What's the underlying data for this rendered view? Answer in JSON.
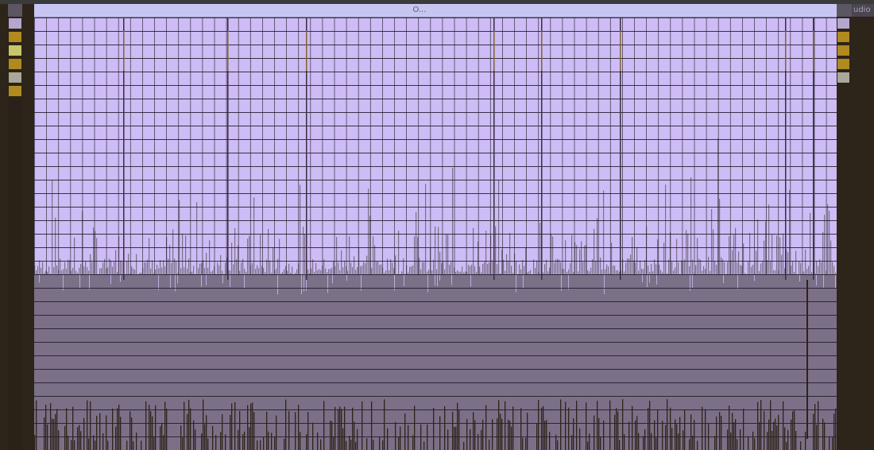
{
  "main_clip": {
    "title": "O..."
  },
  "right_track": {
    "label": "udio"
  },
  "colors": {
    "clip_fill": "#cdbcf5",
    "clip_header": "#c7c6f2",
    "clip_shadow": "#7c7088",
    "background": "#2d241a",
    "grid_line": "#1f1a24",
    "accent_gold": "#b08a1f",
    "accent_yellow_green": "#c9c46a"
  },
  "left_mini_clips": [
    {
      "color": "#b4a6cf"
    },
    {
      "color": "#b08a1f"
    },
    {
      "color": "#c9c46a"
    },
    {
      "color": "#b08a1f"
    },
    {
      "color": "#a9a89a"
    },
    {
      "color": "#b08a1f"
    }
  ],
  "right_mini_clips": [
    {
      "color": "#b4a6cf"
    },
    {
      "color": "#b08a1f"
    },
    {
      "color": "#b08a1f"
    },
    {
      "color": "#b08a1f"
    },
    {
      "color": "#a9a89a"
    }
  ]
}
